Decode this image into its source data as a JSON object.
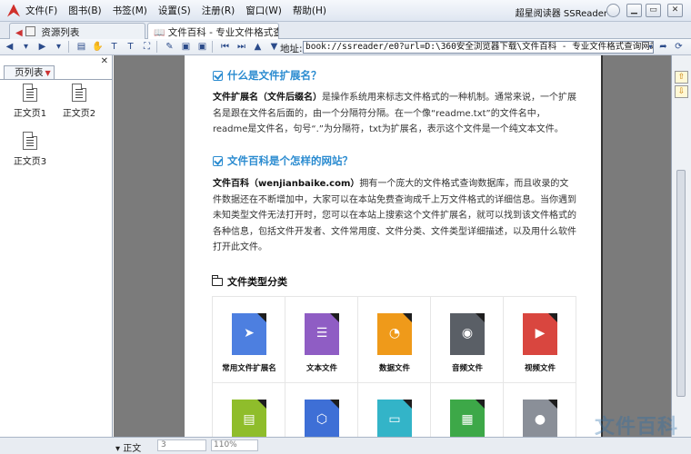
{
  "menubar": {
    "items": [
      "文件(F)",
      "图书(B)",
      "书签(M)",
      "设置(S)",
      "注册(R)",
      "窗口(W)",
      "帮助(H)"
    ],
    "app_title": "超星阅读器 SSReader"
  },
  "tabs": {
    "resources": "资源列表",
    "document": "文件百科 - 专业文件格式查"
  },
  "toolbar": {
    "address_label": "地址:",
    "address_value": "book://ssreader/e0?url=D:\\360安全浏览器下载\\文件百科 - 专业文件格式查询网站.pdg"
  },
  "left_panel": {
    "tab_label": "页列表",
    "pages": [
      "正文页1",
      "正文页2",
      "正文页3"
    ]
  },
  "content": {
    "heading1": "什么是文件扩展名？",
    "para1_bold": "文件扩展名（文件后缀名）",
    "para1_rest": "是操作系统用来标志文件格式的一种机制。通常来说，一个扩展名是跟在文件名后面的，由一个分隔符分隔。在一个像“readme.txt”的文件名中，readme是文件名，句号“.”为分隔符，txt为扩展名，表示这个文件是一个纯文本文件。",
    "heading2": "文件百科是个怎样的网站？",
    "para2_bold": "文件百科（wenjianbaike.com）",
    "para2_rest": "拥有一个庞大的文件格式查询数据库，而且收录的文件数据还在不断增加中，大家可以在本站免费查询成千上万文件格式的详细信息。当你遇到未知类型文件无法打开时，您可以在本站上搜索这个文件扩展名，就可以找到该文件格式的各种信息，包括文件开发者、文件常用度、文件分类、文件类型详细描述，以及用什么软件打开此文件。",
    "category_heading": "文件类型分类",
    "categories": [
      {
        "label": "常用文件扩展名",
        "color": "#4d7fe0",
        "glyph": "➤"
      },
      {
        "label": "文本文件",
        "color": "#8f5dc4",
        "glyph": "☰"
      },
      {
        "label": "数据文件",
        "color": "#ef9a1a",
        "glyph": "◔"
      },
      {
        "label": "音频文件",
        "color": "#5a5f66",
        "glyph": "◉"
      },
      {
        "label": "视频文件",
        "color": "#d9463f",
        "glyph": "▶"
      }
    ],
    "categories_row2_colors": [
      "#8fbd2b",
      "#3e6fd6",
      "#33b4c8",
      "#3da848",
      "#8a8f98"
    ]
  },
  "statusbar": {
    "page_label": "正文",
    "zoom": "110%",
    "page_input": "3"
  },
  "watermark": "文件百科"
}
